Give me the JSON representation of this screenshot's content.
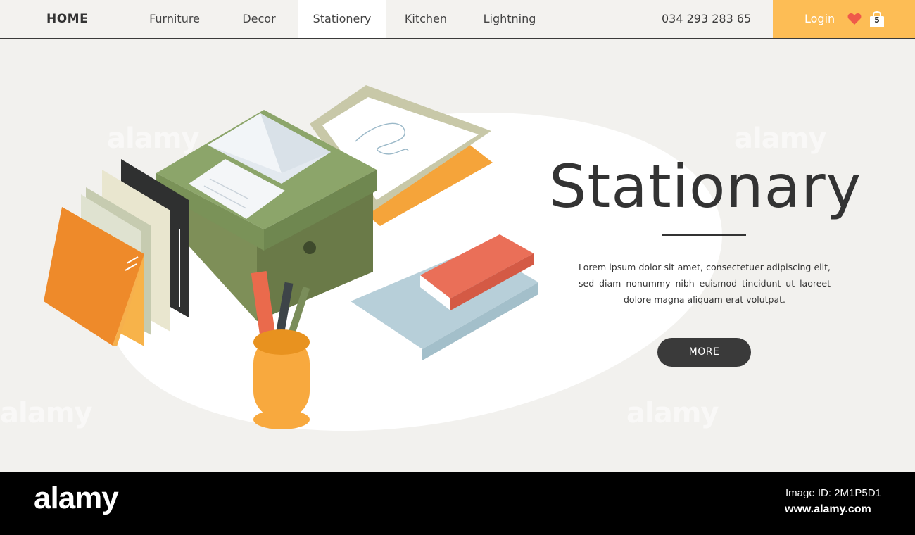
{
  "nav": {
    "home": "HOME",
    "items": [
      {
        "label": "Furniture"
      },
      {
        "label": "Decor"
      },
      {
        "label": "Stationery"
      },
      {
        "label": "Kitchen"
      },
      {
        "label": "Lightning"
      }
    ],
    "active_item": "Stationery",
    "phone": "034 293 283 65",
    "login": "Login",
    "cart_count": "5"
  },
  "hero": {
    "title": "Stationary",
    "body": "Lorem ipsum dolor sit amet, consectetuer adipiscing elit, sed diam nonummy nibh euismod tincidunt ut laoreet dolore magna aliquam erat volutpat.",
    "button": "MORE"
  },
  "watermark": {
    "text": "alamy"
  },
  "footer": {
    "logo": "alamy",
    "image_id": "Image ID: 2M1P5D1",
    "url": "www.alamy.com"
  },
  "colors": {
    "accent": "#fdbd55",
    "nav_background": "#f3f2ef",
    "dark": "#3a3a3a",
    "hero_background": "#f2f1ee"
  }
}
